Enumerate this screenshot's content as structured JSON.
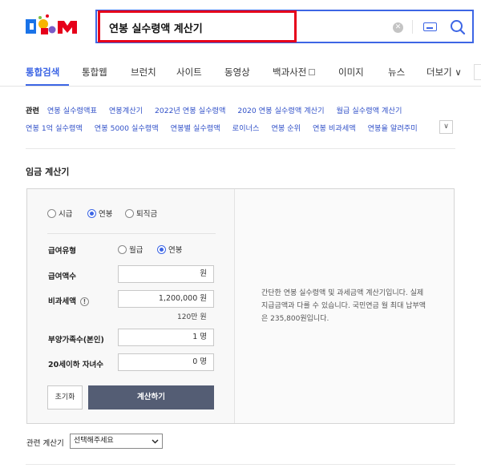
{
  "search": {
    "query": "연봉 실수령액 계산기",
    "clear_label": "✕"
  },
  "tabs": [
    {
      "label": "통합검색",
      "active": true
    },
    {
      "label": "통합웹",
      "active": false
    },
    {
      "label": "브런치",
      "active": false
    },
    {
      "label": "사이트",
      "active": false
    },
    {
      "label": "동영상",
      "active": false
    },
    {
      "label": "백과사전",
      "active": false
    },
    {
      "label": "이미지",
      "active": false
    },
    {
      "label": "뉴스",
      "active": false
    },
    {
      "label": "더보기 ∨",
      "active": false
    }
  ],
  "related": {
    "label": "관련",
    "row1": [
      "연봉 실수령액표",
      "연봉계산기",
      "2022년 연봉 실수령액",
      "2020 연봉 실수령액 계산기",
      "월급 실수령액 계산기"
    ],
    "row2": [
      "연봉 1억 실수령액",
      "연봉 5000 실수령액",
      "연봉별 실수령액",
      "로이너스",
      "연봉 순위",
      "연봉 비과세액",
      "연봉을 알려주미"
    ],
    "toggle": "∨"
  },
  "calculator": {
    "title": "임금 계산기",
    "mode_options": [
      {
        "label": "시급",
        "selected": false
      },
      {
        "label": "연봉",
        "selected": true
      },
      {
        "label": "퇴직금",
        "selected": false
      }
    ],
    "pay_type": {
      "label": "급여유형",
      "options": [
        {
          "label": "월급",
          "selected": false
        },
        {
          "label": "연봉",
          "selected": true
        }
      ]
    },
    "salary": {
      "label": "급여액수",
      "value": "원"
    },
    "nontaxable": {
      "label": "비과세액",
      "value": "1,200,000 원",
      "hint": "120만 원",
      "info": "!"
    },
    "dependents": {
      "label": "부양가족수(본인)",
      "value": "1 명"
    },
    "children": {
      "label": "20세이하 자녀수",
      "value": "0 명"
    },
    "reset_label": "초기화",
    "calc_label": "계산하기",
    "description": "간단한 연봉 실수령액 및 과세금액 계산기입니다. 실제 지급금액과 다를 수 있습니다. 국민연금 월 최대 납부액은 235,800원입니다."
  },
  "related_calc": {
    "label": "관련 계산기",
    "selected": "선택해주세요"
  },
  "colors": {
    "accent": "#3d66e5",
    "highlight": "#e6001a",
    "button": "#545d74"
  }
}
